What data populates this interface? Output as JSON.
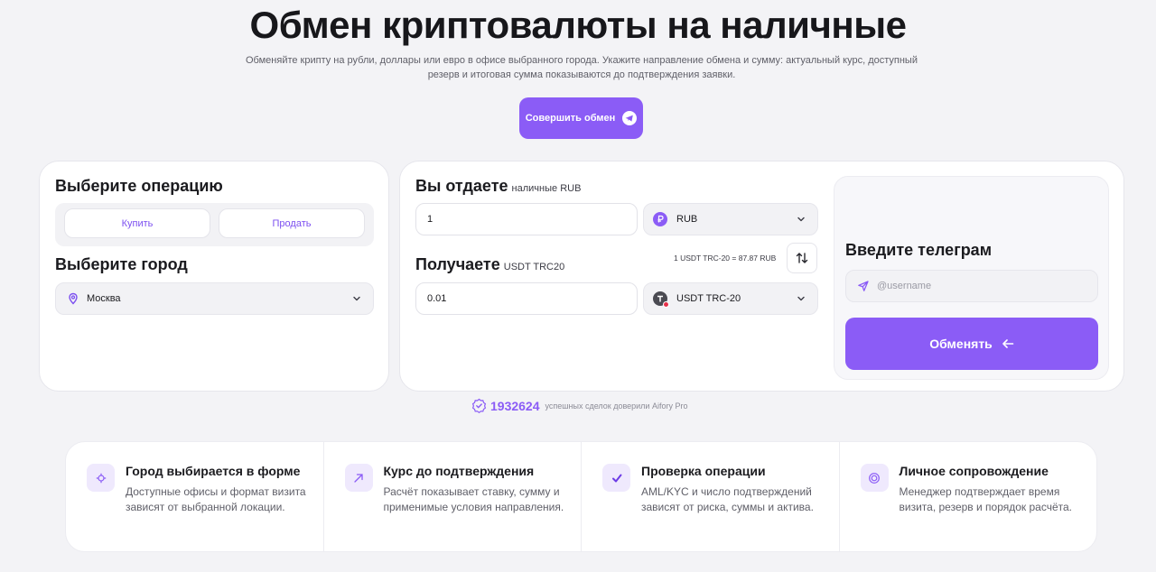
{
  "hero": {
    "title": "Обмен криптовалюты на наличные",
    "subtitle": "Обменяйте крипту на рубли, доллары или евро в офисе выбранного города. Укажите направление обмена и сумму: актуальный курс, доступный резерв и итоговая сумма показываются до подтверждения заявки.",
    "cta_label": "Совершить обмен"
  },
  "operation": {
    "title": "Выберите операцию",
    "buy_label": "Купить",
    "sell_label": "Продать"
  },
  "city": {
    "title": "Выберите город",
    "selected": "Москва"
  },
  "give": {
    "title": "Вы отдаете",
    "subtitle": "наличные RUB",
    "amount": "1",
    "currency": "RUB"
  },
  "receive": {
    "title": "Получаете",
    "subtitle": "USDT TRC20",
    "amount": "0.01",
    "currency": "USDT TRC-20"
  },
  "rate_text": "1 USDT TRC-20 = 87.87 RUB",
  "telegram": {
    "title": "Введите телеграм",
    "placeholder": "@username",
    "submit_label": "Обменять"
  },
  "trust": {
    "count": "1932624",
    "text": "успешных сделок доверили Aifory Pro"
  },
  "features": [
    {
      "icon": "target-icon",
      "title": "Город выбирается в форме",
      "desc": "Доступные офисы и формат визита зависят от выбранной локации."
    },
    {
      "icon": "arrow-up-right-icon",
      "title": "Курс до подтверждения",
      "desc": "Расчёт показывает ставку, сумму и применимые условия направления."
    },
    {
      "icon": "check-icon",
      "title": "Проверка операции",
      "desc": "AML/KYC и число подтверждений зависят от риска, суммы и актива."
    },
    {
      "icon": "circle-icon",
      "title": "Личное сопровождение",
      "desc": "Менеджер подтверждает время визита, резерв и порядок расчёта."
    }
  ],
  "colors": {
    "accent": "#8b5cf6",
    "background": "#f3f3f6"
  }
}
